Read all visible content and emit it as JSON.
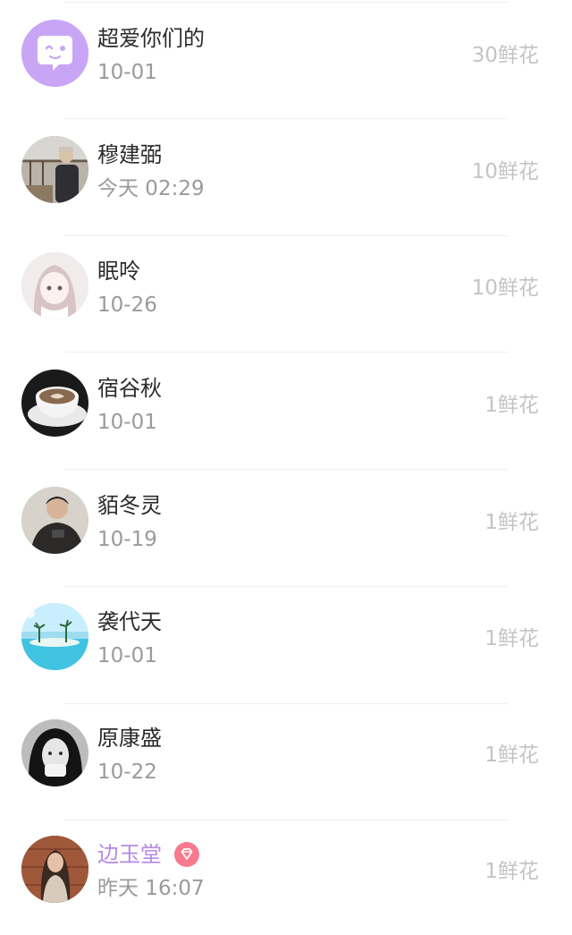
{
  "flower_list": [
    {
      "name": "超爱你们的",
      "time": "10-01",
      "flowers": "30鲜花",
      "avatar": "chat-bubble-icon"
    },
    {
      "name": "穆建弼",
      "time": "今天 02:29",
      "flowers": "10鲜花",
      "avatar": "photo-person-outdoor"
    },
    {
      "name": "眠呤",
      "time": "10-26",
      "flowers": "10鲜花",
      "avatar": "photo-anime-girl"
    },
    {
      "name": "宿谷秋",
      "time": "10-01",
      "flowers": "1鲜花",
      "avatar": "photo-coffee-cup"
    },
    {
      "name": "貊冬灵",
      "time": "10-19",
      "flowers": "1鲜花",
      "avatar": "photo-person-phone"
    },
    {
      "name": "袭代天",
      "time": "10-01",
      "flowers": "1鲜花",
      "avatar": "photo-beach"
    },
    {
      "name": "原康盛",
      "time": "10-22",
      "flowers": "1鲜花",
      "avatar": "photo-girl-bw"
    },
    {
      "name": "边玉堂",
      "time": "昨天 16:07",
      "flowers": "1鲜花",
      "avatar": "photo-girl-brown",
      "badge": "diamond-icon"
    }
  ],
  "colors": {
    "name": "#2b2b2b",
    "vip_name": "#b68ae6",
    "time": "#9a9a9a",
    "flowers": "#c4c4c4",
    "badge": "#f77a8e",
    "avatar_purple": "#c9a6f5"
  }
}
